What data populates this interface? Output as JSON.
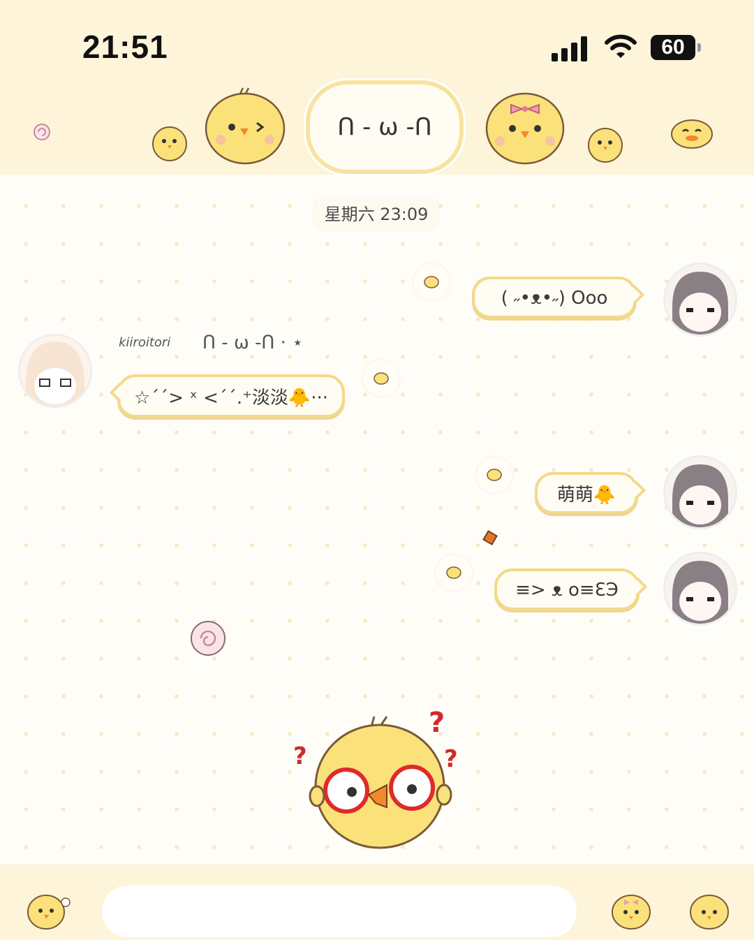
{
  "status_bar": {
    "time": "21:51",
    "battery": "60"
  },
  "header": {
    "title": "ᑎ - ω -ᑎ"
  },
  "chat": {
    "date_label": "星期六 23:09",
    "messages": [
      {
        "side": "right",
        "text": "( ˶•ᴥ•˶) Ooo"
      },
      {
        "side": "left",
        "sender": "kiiroitori",
        "sender_status": "ᑎ - ω -ᑎ · ⋆",
        "text": "☆ˊˊ> ˣ <ˊˊ.⁺淡淡🐥···"
      },
      {
        "side": "right",
        "text": "萌萌🐥"
      },
      {
        "side": "right",
        "text": "≡> ᴥ o≡ƐЭ"
      }
    ]
  },
  "sticker": {
    "marks": "? ? ?"
  },
  "input": {
    "placeholder": ""
  },
  "colors": {
    "header_bg": "#fdf4d9",
    "bubble_border": "#f3d98a",
    "chick": "#fbe17a",
    "dot": "#f7e8c0"
  }
}
